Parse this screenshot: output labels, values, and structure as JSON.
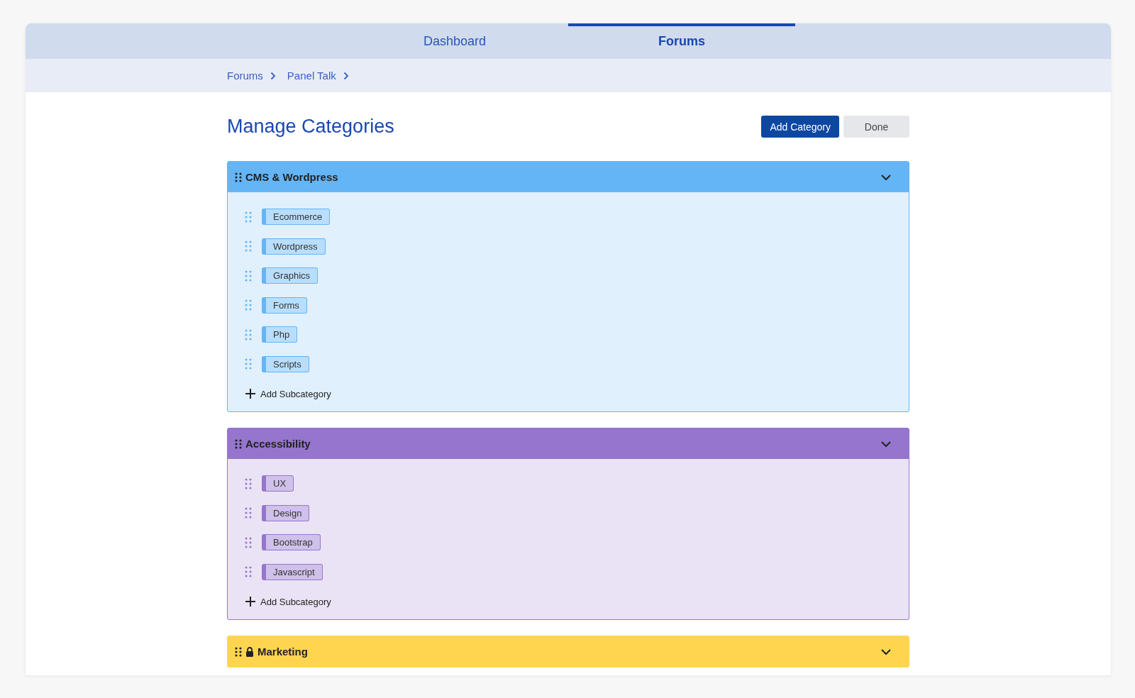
{
  "tabs": [
    {
      "label": "Dashboard",
      "selected": false
    },
    {
      "label": "Forums",
      "selected": true
    }
  ],
  "breadcrumb": [
    "Forums",
    "Panel Talk"
  ],
  "title": "Manage Categories",
  "buttons": [
    {
      "label": "Add Category",
      "kind": "primary"
    },
    {
      "label": "Done",
      "kind": "secondary"
    }
  ],
  "categories": [
    {
      "name": "CMS & Wordpress",
      "color": "#64b5f6",
      "locked": false,
      "subcategories": [
        "Ecommerce",
        "Wordpress",
        "Graphics",
        "Forms",
        "Php",
        "Scripts"
      ],
      "add_label": "Add Subcategory"
    },
    {
      "name": "Accessibility",
      "color": "#9575cd",
      "locked": false,
      "subcategories": [
        "UX",
        "Design",
        "Bootstrap",
        "Javascript"
      ],
      "add_label": "Add Subcategory"
    },
    {
      "name": "Marketing",
      "color": "#ffd54f",
      "locked": true
    }
  ]
}
